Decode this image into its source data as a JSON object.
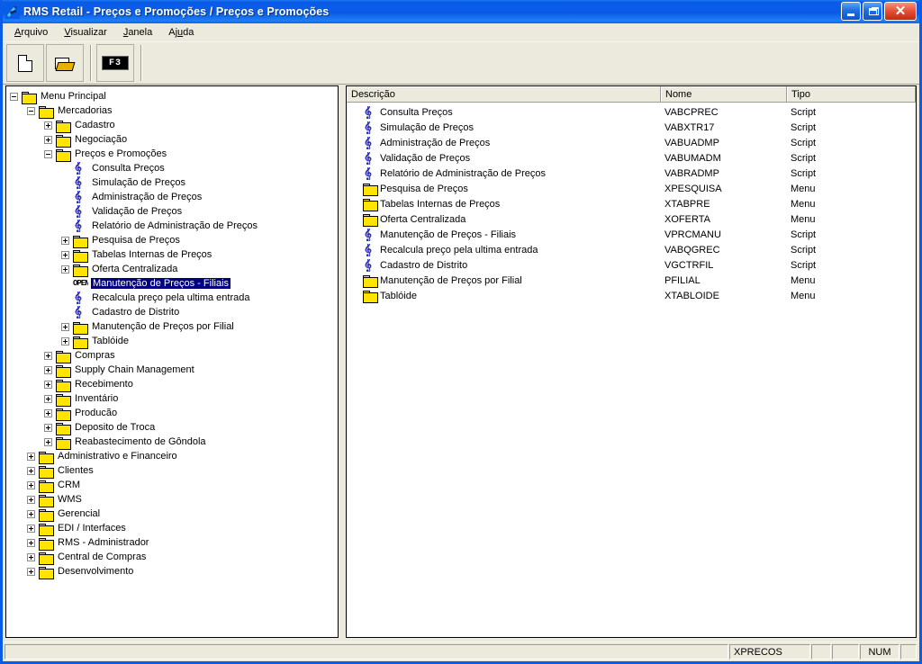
{
  "window": {
    "title": "RMS Retail - Preços e Promoções / Preços e Promoções",
    "app_icon": "rms-app-icon",
    "minimize_label": "",
    "restore_label": "",
    "close_label": "✕"
  },
  "menubar": [
    {
      "label": "Arquivo",
      "accel": "A"
    },
    {
      "label": "Visualizar",
      "accel": "V"
    },
    {
      "label": "Janela",
      "accel": "J"
    },
    {
      "label": "Ajuda",
      "accel": "u"
    }
  ],
  "toolbar": {
    "buttons": [
      {
        "name": "new-document-button",
        "icon": "new-document-icon",
        "label": ""
      },
      {
        "name": "open-folder-button",
        "icon": "open-folder-icon",
        "label": ""
      },
      {
        "name": "f3-shortcut-button",
        "icon": "f3-key-icon",
        "label": "F3"
      }
    ]
  },
  "tree": {
    "nodes": [
      {
        "label": "Menu Principal",
        "depth": 0,
        "icon": "folder",
        "state": "expanded",
        "selected": false
      },
      {
        "label": "Mercadorias",
        "depth": 1,
        "icon": "folder",
        "state": "expanded",
        "selected": false
      },
      {
        "label": "Cadastro",
        "depth": 2,
        "icon": "folder",
        "state": "collapsed",
        "selected": false
      },
      {
        "label": "Negociação",
        "depth": 2,
        "icon": "folder",
        "state": "collapsed",
        "selected": false
      },
      {
        "label": "Preços e Promoções",
        "depth": 2,
        "icon": "folder",
        "state": "expanded",
        "selected": false
      },
      {
        "label": "Consulta Preços",
        "depth": 3,
        "icon": "script",
        "state": "leaf",
        "selected": false
      },
      {
        "label": "Simulação de Preços",
        "depth": 3,
        "icon": "script",
        "state": "leaf",
        "selected": false
      },
      {
        "label": "Administração de Preços",
        "depth": 3,
        "icon": "script",
        "state": "leaf",
        "selected": false
      },
      {
        "label": "Validação de Preços",
        "depth": 3,
        "icon": "script",
        "state": "leaf",
        "selected": false
      },
      {
        "label": "Relatório de Administração de Preços",
        "depth": 3,
        "icon": "script",
        "state": "leaf",
        "selected": false
      },
      {
        "label": "Pesquisa de Preços",
        "depth": 3,
        "icon": "folder",
        "state": "collapsed",
        "selected": false
      },
      {
        "label": "Tabelas Internas de Preços",
        "depth": 3,
        "icon": "folder",
        "state": "collapsed",
        "selected": false
      },
      {
        "label": "Oferta Centralizada",
        "depth": 3,
        "icon": "folder",
        "state": "collapsed",
        "selected": false
      },
      {
        "label": "Manutenção de Preços - Filiais",
        "depth": 3,
        "icon": "open",
        "state": "leaf",
        "selected": true
      },
      {
        "label": "Recalcula preço pela ultima entrada",
        "depth": 3,
        "icon": "script",
        "state": "leaf",
        "selected": false
      },
      {
        "label": "Cadastro de Distrito",
        "depth": 3,
        "icon": "script",
        "state": "leaf",
        "selected": false
      },
      {
        "label": "Manutenção de Preços por Filial",
        "depth": 3,
        "icon": "folder",
        "state": "collapsed",
        "selected": false
      },
      {
        "label": "Tablóide",
        "depth": 3,
        "icon": "folder",
        "state": "collapsed",
        "selected": false
      },
      {
        "label": "Compras",
        "depth": 2,
        "icon": "folder",
        "state": "collapsed",
        "selected": false
      },
      {
        "label": "Supply Chain Management",
        "depth": 2,
        "icon": "folder",
        "state": "collapsed",
        "selected": false
      },
      {
        "label": "Recebimento",
        "depth": 2,
        "icon": "folder",
        "state": "collapsed",
        "selected": false
      },
      {
        "label": "Inventário",
        "depth": 2,
        "icon": "folder",
        "state": "collapsed",
        "selected": false
      },
      {
        "label": "Producão",
        "depth": 2,
        "icon": "folder",
        "state": "collapsed",
        "selected": false
      },
      {
        "label": "Deposito de Troca",
        "depth": 2,
        "icon": "folder",
        "state": "collapsed",
        "selected": false
      },
      {
        "label": "Reabastecimento de Gôndola",
        "depth": 2,
        "icon": "folder",
        "state": "collapsed",
        "selected": false
      },
      {
        "label": "Administrativo e Financeiro",
        "depth": 1,
        "icon": "folder",
        "state": "collapsed",
        "selected": false
      },
      {
        "label": "Clientes",
        "depth": 1,
        "icon": "folder",
        "state": "collapsed",
        "selected": false
      },
      {
        "label": "CRM",
        "depth": 1,
        "icon": "folder",
        "state": "collapsed",
        "selected": false
      },
      {
        "label": "WMS",
        "depth": 1,
        "icon": "folder",
        "state": "collapsed",
        "selected": false
      },
      {
        "label": "Gerencial",
        "depth": 1,
        "icon": "folder",
        "state": "collapsed",
        "selected": false
      },
      {
        "label": "EDI / Interfaces",
        "depth": 1,
        "icon": "folder",
        "state": "collapsed",
        "selected": false
      },
      {
        "label": "RMS - Administrador",
        "depth": 1,
        "icon": "folder",
        "state": "collapsed",
        "selected": false
      },
      {
        "label": "Central de Compras",
        "depth": 1,
        "icon": "folder",
        "state": "collapsed",
        "selected": false
      },
      {
        "label": "Desenvolvimento",
        "depth": 1,
        "icon": "folder",
        "state": "collapsed",
        "selected": false
      }
    ]
  },
  "list": {
    "columns": [
      {
        "label": "Descrição"
      },
      {
        "label": "Nome"
      },
      {
        "label": "Tipo"
      }
    ],
    "rows": [
      {
        "descricao": "Consulta Preços",
        "nome": "VABCPREC",
        "tipo": "Script",
        "icon": "script"
      },
      {
        "descricao": "Simulação de Preços",
        "nome": "VABXTR17",
        "tipo": "Script",
        "icon": "script"
      },
      {
        "descricao": "Administração de Preços",
        "nome": "VABUADMP",
        "tipo": "Script",
        "icon": "script"
      },
      {
        "descricao": "Validação de Preços",
        "nome": "VABUMADM",
        "tipo": "Script",
        "icon": "script"
      },
      {
        "descricao": "Relatório de Administração de Preços",
        "nome": "VABRADMP",
        "tipo": "Script",
        "icon": "script"
      },
      {
        "descricao": "Pesquisa de Preços",
        "nome": "XPESQUISA",
        "tipo": "Menu",
        "icon": "folder"
      },
      {
        "descricao": "Tabelas Internas de Preços",
        "nome": "XTABPRE",
        "tipo": "Menu",
        "icon": "folder"
      },
      {
        "descricao": "Oferta Centralizada",
        "nome": "XOFERTA",
        "tipo": "Menu",
        "icon": "folder"
      },
      {
        "descricao": "Manutenção de Preços - Filiais",
        "nome": "VPRCMANU",
        "tipo": "Script",
        "icon": "script"
      },
      {
        "descricao": "Recalcula preço pela ultima entrada",
        "nome": "VABQGREC",
        "tipo": "Script",
        "icon": "script"
      },
      {
        "descricao": "Cadastro de Distrito",
        "nome": "VGCTRFIL",
        "tipo": "Script",
        "icon": "script"
      },
      {
        "descricao": "Manutenção de Preços por Filial",
        "nome": "PFILIAL",
        "tipo": "Menu",
        "icon": "folder"
      },
      {
        "descricao": "Tablóide",
        "nome": "XTABLOIDE",
        "tipo": "Menu",
        "icon": "folder"
      }
    ]
  },
  "statusbar": {
    "message": "",
    "context_code": "XPRECOS",
    "pane_a": "",
    "pane_b": "",
    "num_indicator": "NUM",
    "pane_c": ""
  },
  "colors": {
    "titlebar_blue": "#0a5ce8",
    "selection_navy": "#000080",
    "folder_yellow": "#ffe400",
    "script_blue": "#2a2ab0",
    "chrome_beige": "#ece9dd",
    "close_red": "#c22b10"
  }
}
